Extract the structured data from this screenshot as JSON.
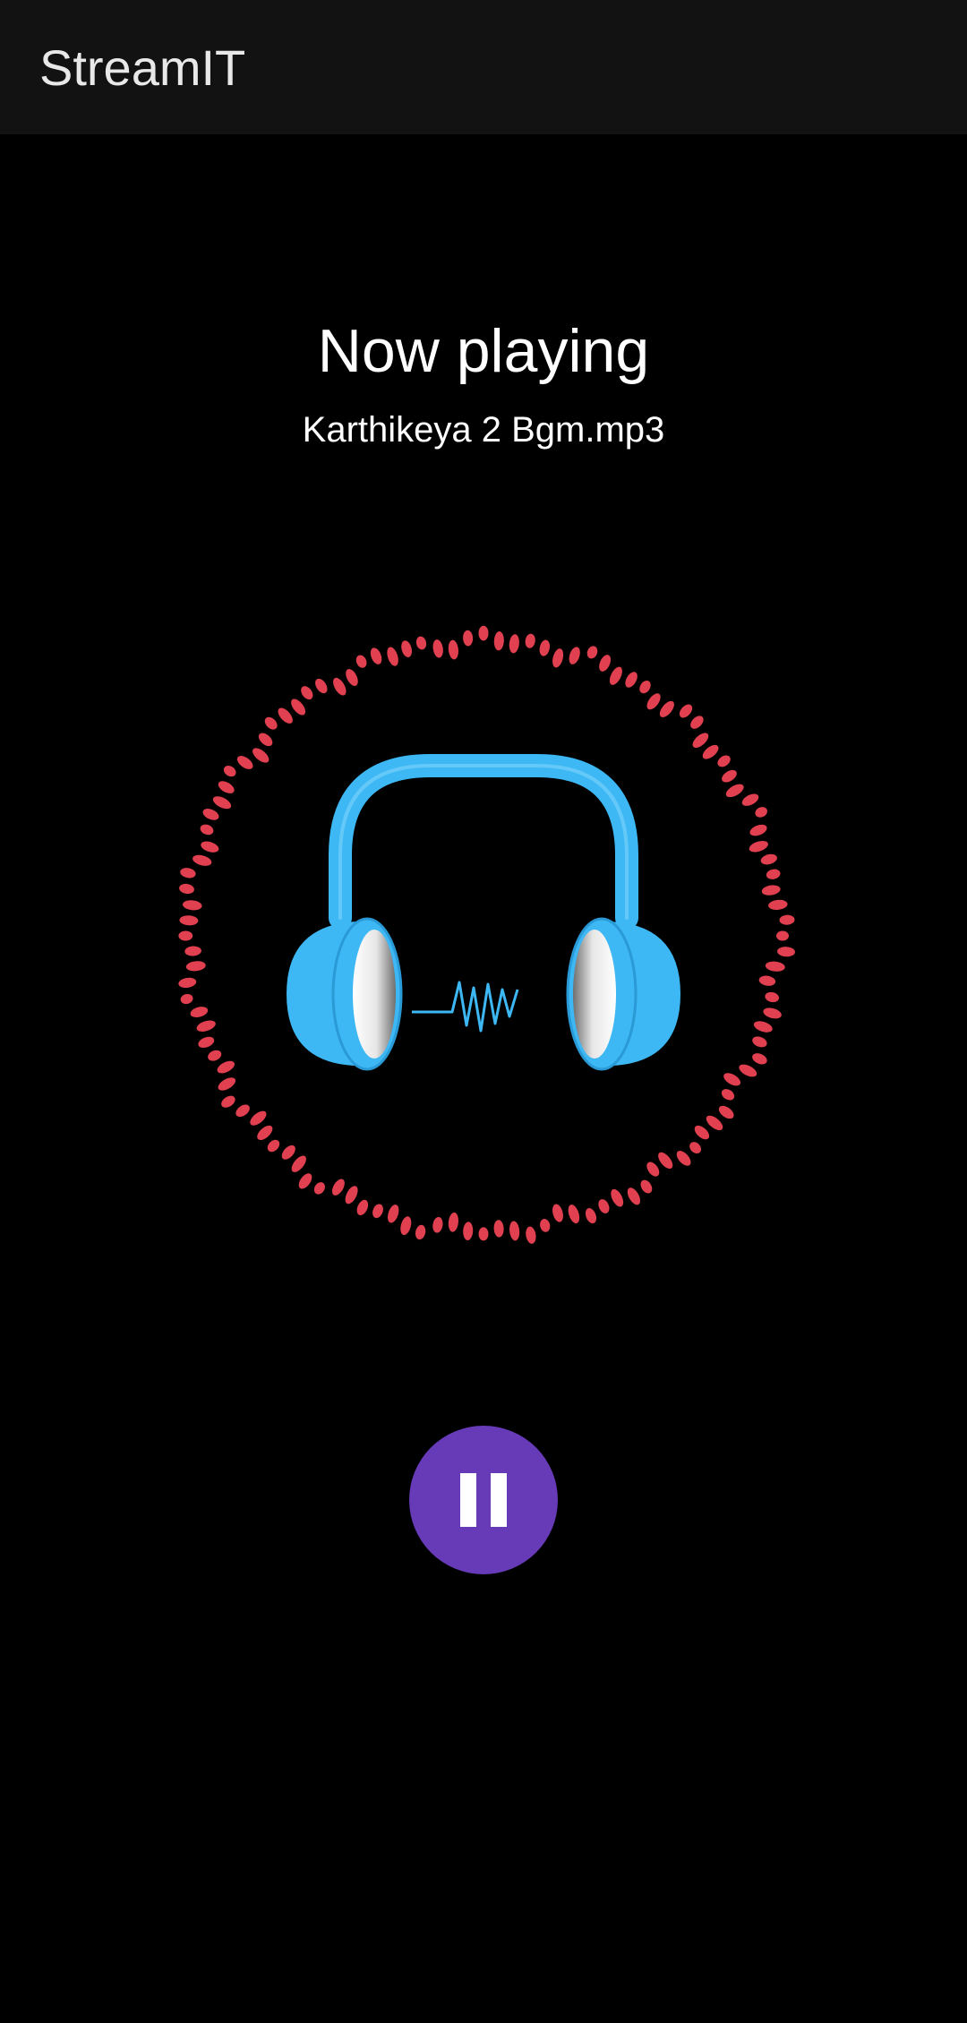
{
  "app": {
    "title": "StreamIT"
  },
  "player": {
    "heading": "Now playing",
    "track_name": "Karthikeya 2 Bgm.mp3",
    "state": "playing",
    "control_icon": "pause-icon"
  },
  "visualizer": {
    "icon": "audio-visualizer-ring",
    "dot_color": "#e0404f"
  },
  "artwork": {
    "icon": "headphones-icon",
    "color": "#3db8f5"
  },
  "colors": {
    "background": "#000000",
    "app_bar": "#121212",
    "accent": "#673ab7"
  }
}
